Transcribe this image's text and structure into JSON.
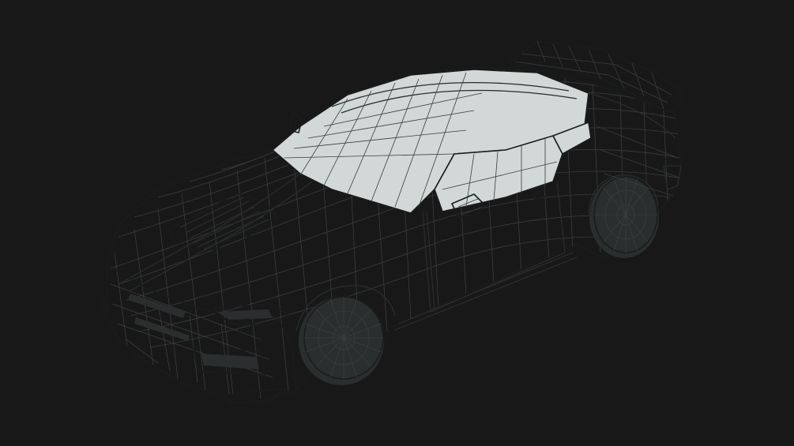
{
  "scene": {
    "subject": "car-wireframe-model",
    "view": "perspective",
    "shading": "wireframe-on-shaded"
  },
  "colors": {
    "background": "#181818",
    "surface": "#dde3e2",
    "edge": "#1a1c1c",
    "wire": "#3a3d3d"
  }
}
